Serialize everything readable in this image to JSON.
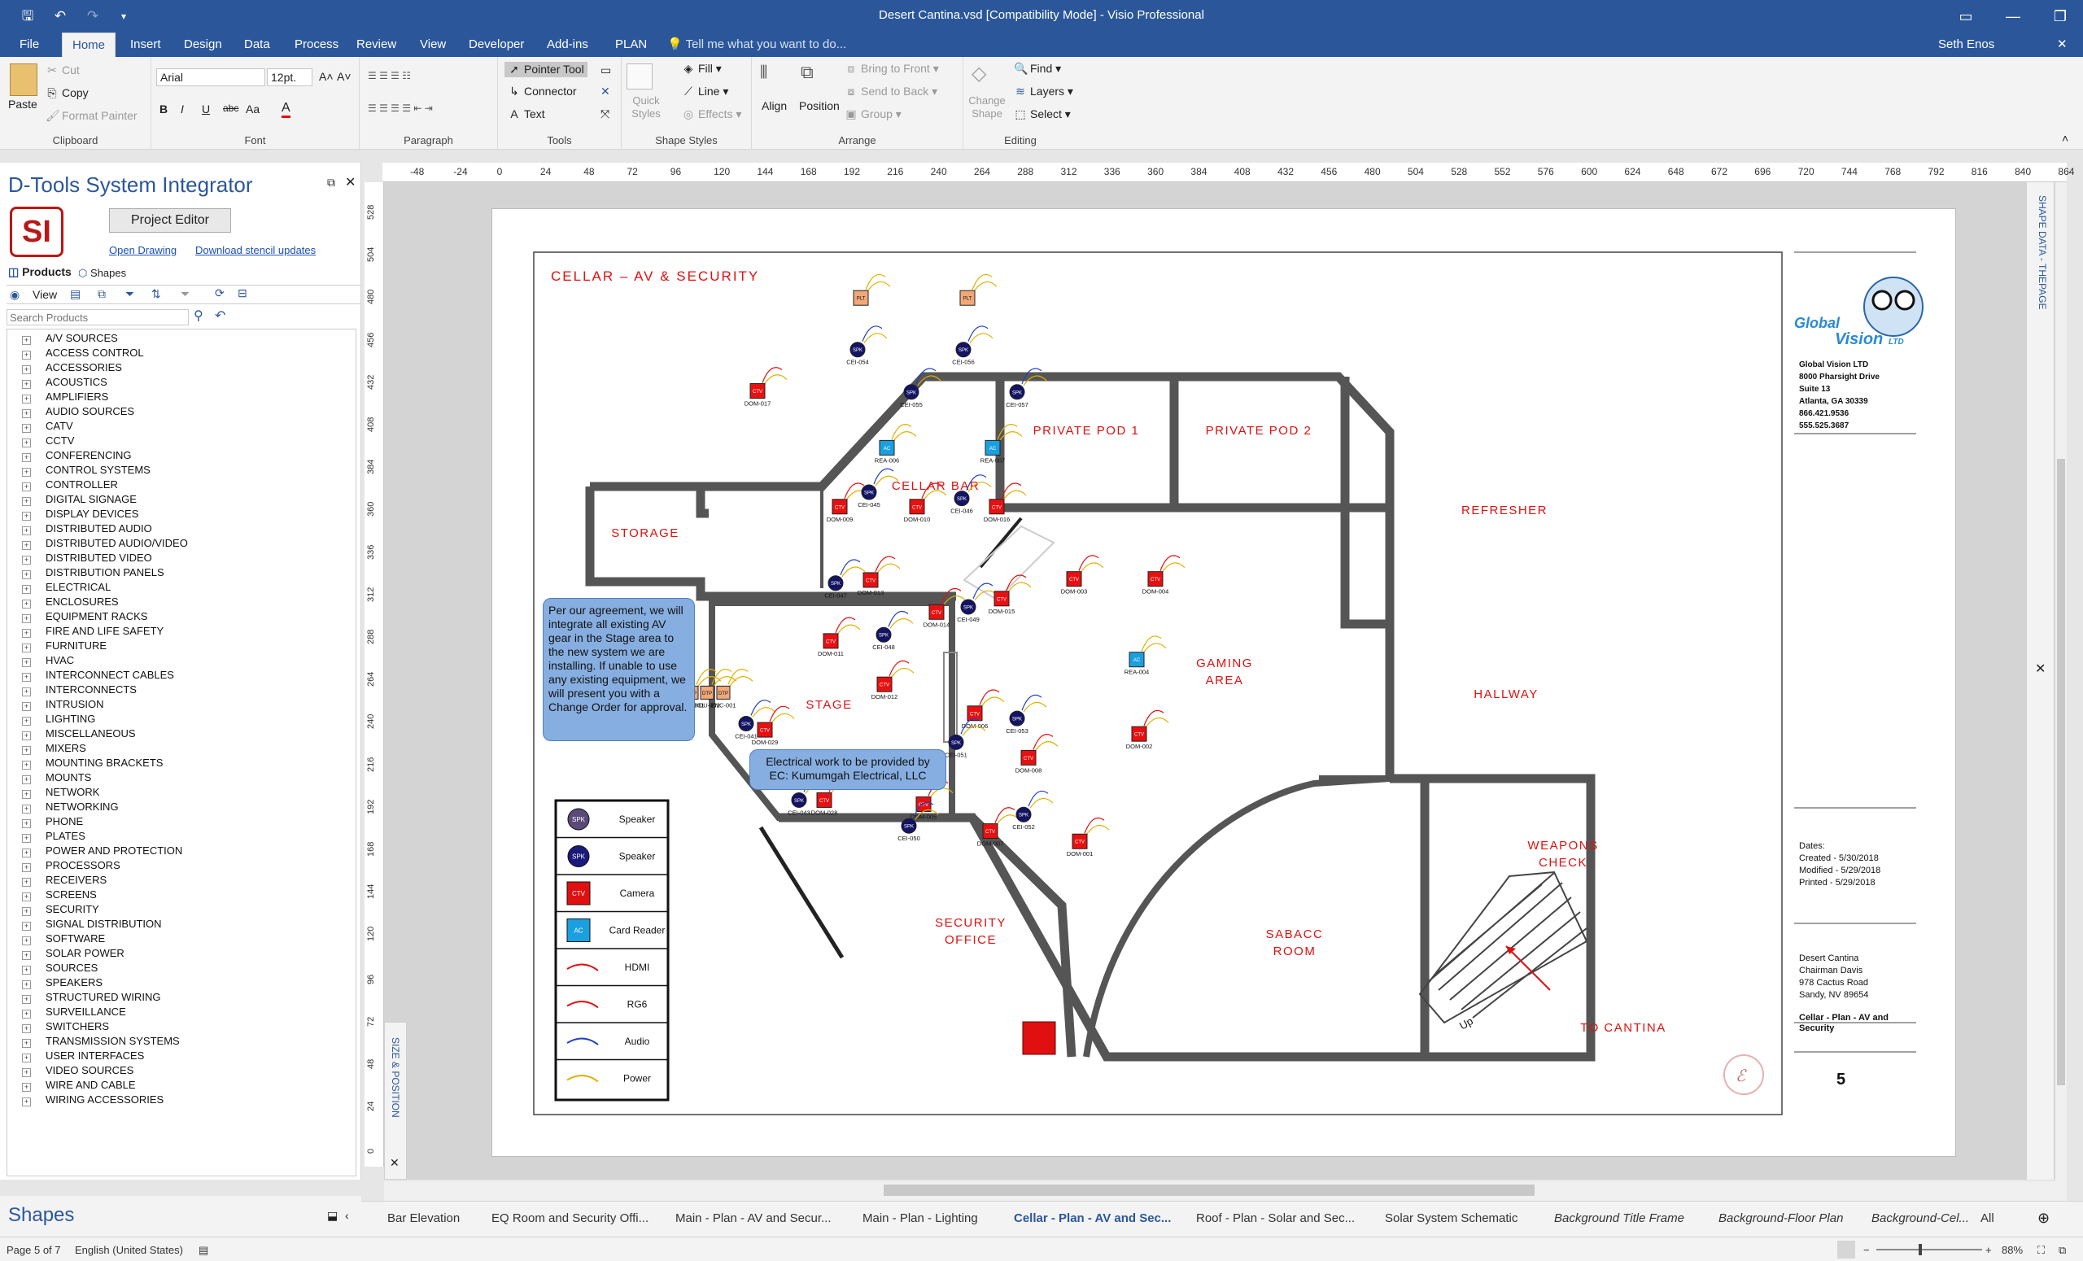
{
  "window": {
    "title": "Desert Cantina.vsd  [Compatibility Mode] - Visio Professional",
    "user": "Seth Enos",
    "tell_me": "Tell me what you want to do..."
  },
  "tabs": [
    "File",
    "Home",
    "Insert",
    "Design",
    "Data",
    "Process",
    "Review",
    "View",
    "Developer",
    "Add-ins",
    "PLAN"
  ],
  "ribbon": {
    "clipboard": {
      "paste": "Paste",
      "cut": "Cut",
      "copy": "Copy",
      "format_painter": "Format Painter",
      "label": "Clipboard"
    },
    "font": {
      "font_name": "Arial",
      "font_size": "12pt.",
      "bold": "B",
      "italic": "I",
      "underline": "U",
      "strike": "abc",
      "case": "Aa",
      "color": "A",
      "label": "Font"
    },
    "paragraph": {
      "label": "Paragraph"
    },
    "tools": {
      "pointer": "Pointer Tool",
      "connector": "Connector",
      "text": "Text",
      "label": "Tools"
    },
    "shape_styles": {
      "quick_styles": "Quick Styles",
      "fill": "Fill",
      "line": "Line",
      "effects": "Effects",
      "label": "Shape Styles"
    },
    "arrange": {
      "align": "Align",
      "position": "Position",
      "bring_front": "Bring to Front",
      "send_back": "Send to Back",
      "group": "Group",
      "label": "Arrange"
    },
    "editing": {
      "change_shape": "Change Shape",
      "find": "Find",
      "layers": "Layers",
      "select": "Select",
      "label": "Editing"
    }
  },
  "left_pane": {
    "title": "D-Tools System Integrator",
    "logo": "SI",
    "project_editor": "Project Editor",
    "open_drawing": "Open Drawing",
    "download_stencil": "Download stencil updates",
    "tab_products": "Products",
    "tab_shapes": "Shapes",
    "view_label": "View",
    "search_placeholder": "Search Products",
    "categories": [
      "A/V SOURCES",
      "ACCESS CONTROL",
      "ACCESSORIES",
      "ACOUSTICS",
      "AMPLIFIERS",
      "AUDIO SOURCES",
      "CATV",
      "CCTV",
      "CONFERENCING",
      "CONTROL SYSTEMS",
      "CONTROLLER",
      "DIGITAL SIGNAGE",
      "DISPLAY DEVICES",
      "DISTRIBUTED AUDIO",
      "DISTRIBUTED AUDIO/VIDEO",
      "DISTRIBUTED VIDEO",
      "DISTRIBUTION PANELS",
      "ELECTRICAL",
      "ENCLOSURES",
      "EQUIPMENT RACKS",
      "FIRE AND LIFE SAFETY",
      "FURNITURE",
      "HVAC",
      "INTERCONNECT CABLES",
      "INTERCONNECTS",
      "INTRUSION",
      "LIGHTING",
      "MISCELLANEOUS",
      "MIXERS",
      "MOUNTING BRACKETS",
      "MOUNTS",
      "NETWORK",
      "NETWORKING",
      "PHONE",
      "PLATES",
      "POWER AND PROTECTION",
      "PROCESSORS",
      "RECEIVERS",
      "SCREENS",
      "SECURITY",
      "SIGNAL DISTRIBUTION",
      "SOFTWARE",
      "SOLAR POWER",
      "SOURCES",
      "SPEAKERS",
      "STRUCTURED WIRING",
      "SURVEILLANCE",
      "SWITCHERS",
      "TRANSMISSION SYSTEMS",
      "USER INTERFACES",
      "VIDEO SOURCES",
      "WIRE AND CABLE",
      "WIRING ACCESSORIES"
    ]
  },
  "shapes_pane_title": "Shapes",
  "ruler": {
    "h": [
      "-48",
      "-24",
      "0",
      "24",
      "48",
      "72",
      "96",
      "120",
      "144",
      "168",
      "192",
      "216",
      "240",
      "264",
      "288",
      "312",
      "336",
      "360",
      "384",
      "408",
      "432",
      "456",
      "480",
      "504",
      "528",
      "552",
      "576",
      "600",
      "624",
      "648",
      "672",
      "696",
      "720",
      "744",
      "768",
      "792",
      "816",
      "840",
      "864"
    ],
    "v": [
      "528",
      "504",
      "480",
      "456",
      "432",
      "408",
      "384",
      "360",
      "336",
      "312",
      "288",
      "264",
      "240",
      "216",
      "192",
      "168",
      "144",
      "120",
      "96",
      "72",
      "48",
      "24",
      "0"
    ]
  },
  "size_position_label": "SIZE & POSITION",
  "shape_data_label": "SHAPE DATA - THEPAGE",
  "drawing": {
    "title": "CELLAR – AV & SECURITY",
    "rooms": {
      "storage": "STORAGE",
      "cellar_bar": "CELLAR BAR",
      "pod1": "PRIVATE POD 1",
      "pod2": "PRIVATE POD 2",
      "refresher": "REFRESHER",
      "stage": "STAGE",
      "gaming1": "GAMING",
      "gaming2": "AREA",
      "hallway": "HALLWAY",
      "security1": "SECURITY",
      "security2": "OFFICE",
      "sabacc1": "SABACC",
      "sabacc2": "ROOM",
      "weapons1": "WEAPONS",
      "weapons2": "CHECK",
      "to_cantina": "TO CANTINA",
      "up": "Up"
    },
    "note_agreement": "Per our agreement, we will integrate all existing AV gear in the Stage area to the new system we are installing. If unable to use any existing equipment, we will present you with a Change Order for approval.",
    "note_electrical": "Electrical work to be provided by EC: Kumumgah Electrical, LLC",
    "legend": [
      {
        "code": "SPK",
        "label": "Speaker",
        "color": "#5a4a7a"
      },
      {
        "code": "SPK",
        "label": "Speaker",
        "color": "#1a1a7a"
      },
      {
        "code": "CTV",
        "label": "Camera",
        "color": "#e01010"
      },
      {
        "code": "AC",
        "label": "Card Reader",
        "color": "#1aa0e0"
      },
      {
        "code": "",
        "label": "HDMI",
        "color": "#e01010"
      },
      {
        "code": "",
        "label": "RG6",
        "color": "#e01010"
      },
      {
        "code": "",
        "label": "Audio",
        "color": "#2040c0"
      },
      {
        "code": "",
        "label": "Power",
        "color": "#e0b000"
      }
    ],
    "devices": [
      {
        "code": "PLT",
        "label": ""
      },
      {
        "code": "PLT",
        "label": ""
      },
      {
        "code": "SPK",
        "label": "CEI-054"
      },
      {
        "code": "SPK",
        "label": "CEI-056"
      },
      {
        "code": "SPK",
        "label": "CEI-055"
      },
      {
        "code": "SPK",
        "label": "CEI-057"
      },
      {
        "code": "CTV",
        "label": "DOM-017"
      },
      {
        "code": "AC",
        "label": "REA-006"
      },
      {
        "code": "AC",
        "label": "REA-007"
      },
      {
        "code": "CTV",
        "label": "DOM-009"
      },
      {
        "code": "SPK",
        "label": "CEI-045"
      },
      {
        "code": "CTV",
        "label": "DOM-010"
      },
      {
        "code": "SPK",
        "label": "CEI-046"
      },
      {
        "code": "CTV",
        "label": "DOM-016"
      },
      {
        "code": "SPK",
        "label": "CEI-047"
      },
      {
        "code": "CTV",
        "label": "DOM-013"
      },
      {
        "code": "CTV",
        "label": "DOM-014"
      },
      {
        "code": "SPK",
        "label": "CEI-049"
      },
      {
        "code": "CTV",
        "label": "DOM-015"
      },
      {
        "code": "CTV",
        "label": "DOM-011"
      },
      {
        "code": "SPK",
        "label": "CEI-048"
      },
      {
        "code": "CTV",
        "label": "DOM-012"
      },
      {
        "code": "CTV",
        "label": "DOM-003"
      },
      {
        "code": "CTV",
        "label": "DOM-004"
      },
      {
        "code": "DTP",
        "label": "HDU-001"
      },
      {
        "code": "DTP",
        "label": "HDU-002"
      },
      {
        "code": "DTP",
        "label": "ENC-001"
      },
      {
        "code": "SPK",
        "label": "CEI-041"
      },
      {
        "code": "CTV",
        "label": "DOM-029"
      },
      {
        "code": "SPK",
        "label": "CEI-043"
      },
      {
        "code": "CTV",
        "label": "DOM-028"
      },
      {
        "code": "CTV",
        "label": "DOM-006"
      },
      {
        "code": "SPK",
        "label": "CEI-053"
      },
      {
        "code": "SPK",
        "label": "CEI-051"
      },
      {
        "code": "CTV",
        "label": "DOM-008"
      },
      {
        "code": "CTV",
        "label": "DOM-005"
      },
      {
        "code": "SPK",
        "label": "CEI-050"
      },
      {
        "code": "CTV",
        "label": "DOM-007"
      },
      {
        "code": "SPK",
        "label": "CEI-052"
      },
      {
        "code": "AC",
        "label": "REA-004"
      },
      {
        "code": "CTV",
        "label": "DOM-002"
      },
      {
        "code": "CTV",
        "label": "DOM-001"
      }
    ],
    "company": {
      "logo_text1": "Global",
      "logo_text2": "Vision",
      "logo_text3": "LTD",
      "info": "Global Vision LTD\n8000 Pharsight Drive\nSuite 13\nAtlanta, GA 30339\n866.421.9536\n555.525.3687"
    },
    "dates": "Dates:\nCreated - 5/30/2018\nModified - 5/29/2018\nPrinted - 5/29/2018",
    "client": "Desert Cantina\nChairman Davis\n978 Cactus Road\nSandy, NV 89654",
    "sheet_title": "Cellar - Plan - AV and\nSecurity",
    "page_number": "5"
  },
  "sheet_tabs": [
    {
      "label": "Bar Elevation",
      "style": "normal"
    },
    {
      "label": "EQ Room and Security Offi...",
      "style": "normal"
    },
    {
      "label": "Main - Plan - AV and Secur...",
      "style": "normal"
    },
    {
      "label": "Main - Plan - Lighting",
      "style": "normal"
    },
    {
      "label": "Cellar - Plan - AV and Sec...",
      "style": "active"
    },
    {
      "label": "Roof - Plan - Solar and Sec...",
      "style": "normal"
    },
    {
      "label": "Solar System Schematic",
      "style": "normal"
    },
    {
      "label": "Background Title Frame",
      "style": "italic"
    },
    {
      "label": "Background-Floor Plan",
      "style": "italic"
    },
    {
      "label": "Background-Cel...",
      "style": "italic"
    },
    {
      "label": "All",
      "style": "normal"
    }
  ],
  "status": {
    "page": "Page 5 of 7",
    "language": "English (United States)",
    "zoom": "88%"
  }
}
